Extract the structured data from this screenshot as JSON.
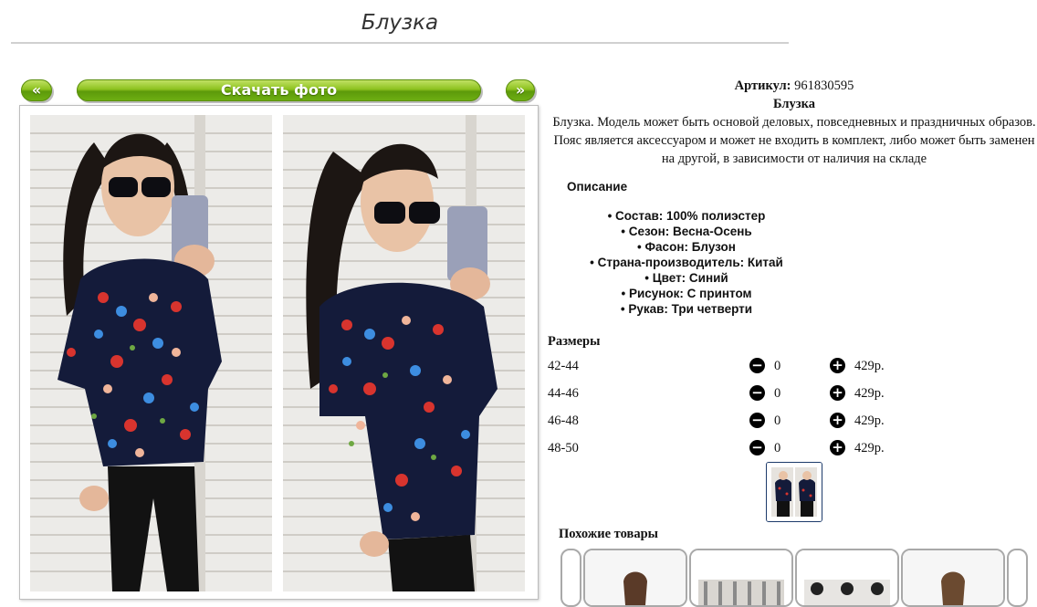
{
  "page": {
    "title": "Блузка"
  },
  "gallery": {
    "prev_label": "«",
    "download_label": "Скачать фото",
    "next_label": "»"
  },
  "product": {
    "sku_label": "Артикул:",
    "sku_value": "961830595",
    "name": "Блузка",
    "description": "Блузка. Модель может быть основой деловых, повседневных и праздничных образов. Пояс является аксессуаром и может не входить в комплект, либо может быть заменен на другой, в зависимости от наличия на складе",
    "description_heading": "Описание",
    "attributes": [
      "Состав: 100% полиэстер",
      "Сезон: Весна-Осень",
      "Фасон: Блузон",
      "Страна-производитель: Китай",
      "Цвет: Синий",
      "Рисунок: С принтом",
      "Рукав: Три четверти"
    ]
  },
  "sizes": {
    "heading": "Размеры",
    "minus_icon": "−",
    "plus_icon": "+",
    "rows": [
      {
        "size": "42-44",
        "qty": "0",
        "price": "429р."
      },
      {
        "size": "44-46",
        "qty": "0",
        "price": "429р."
      },
      {
        "size": "46-48",
        "qty": "0",
        "price": "429р."
      },
      {
        "size": "48-50",
        "qty": "0",
        "price": "429р."
      }
    ]
  },
  "similar": {
    "heading": "Похожие товары"
  },
  "colors": {
    "accent_green": "#8dc21f",
    "print_navy": "#141b3a"
  }
}
